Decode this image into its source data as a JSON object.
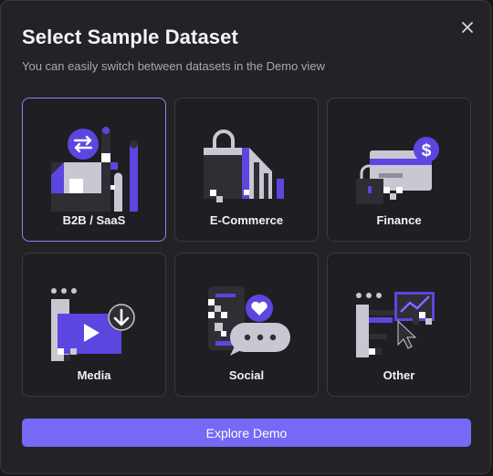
{
  "modal": {
    "title": "Select Sample Dataset",
    "subtitle": "You can easily switch between datasets in the Demo view"
  },
  "datasets": [
    {
      "label": "B2B / SaaS",
      "selected": true,
      "icon": "b2b-saas-illustration"
    },
    {
      "label": "E-Commerce",
      "selected": false,
      "icon": "shopping-bag-illustration"
    },
    {
      "label": "Finance",
      "selected": false,
      "icon": "credit-card-dollar-illustration"
    },
    {
      "label": "Media",
      "selected": false,
      "icon": "video-play-download-illustration"
    },
    {
      "label": "Social",
      "selected": false,
      "icon": "chat-heart-illustration"
    },
    {
      "label": "Other",
      "selected": false,
      "icon": "chart-cursor-illustration"
    }
  ],
  "actions": {
    "explore_label": "Explore Demo",
    "close_icon": "close-icon"
  },
  "colors": {
    "accent": "#7569f5",
    "selected_border": "#8c84f2",
    "illustration_purple": "#5b46e0",
    "illustration_gray": "#c9c8d2",
    "illustration_dark": "#2f2e34"
  }
}
